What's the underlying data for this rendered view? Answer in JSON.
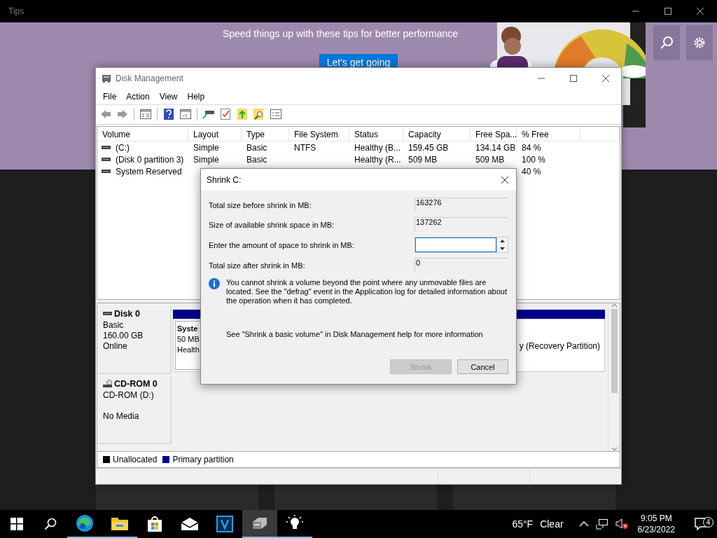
{
  "tips_window": {
    "title": "Tips",
    "banner_text": "Speed things up with these tips for better performance",
    "banner_button": "Let's get going"
  },
  "disk_management": {
    "title": "Disk Management",
    "menu": [
      "File",
      "Action",
      "View",
      "Help"
    ],
    "volume_list": {
      "columns": [
        "Volume",
        "Layout",
        "Type",
        "File System",
        "Status",
        "Capacity",
        "Free Spa...",
        "% Free"
      ],
      "rows": [
        {
          "cells": [
            "(C:)",
            "Simple",
            "Basic",
            "NTFS",
            "Healthy (B...",
            "159.45 GB",
            "134.14 GB",
            "84 %"
          ]
        },
        {
          "cells": [
            "(Disk 0 partition 3)",
            "Simple",
            "Basic",
            null,
            "Healthy (R...",
            "509 MB",
            "509 MB",
            "100 %"
          ]
        },
        {
          "cells": [
            "System Reserved",
            null,
            null,
            null,
            null,
            null,
            null,
            "40 %"
          ]
        }
      ]
    },
    "disks": [
      {
        "kind": "disk",
        "name": "Disk 0",
        "lines": [
          "Basic",
          "160.00 GB",
          "Online"
        ],
        "partitions": [
          {
            "lines": [
              "Syste",
              "50 MB",
              "Health"
            ]
          },
          {
            "lines": [
              "y (Recovery Partition)"
            ]
          }
        ]
      },
      {
        "kind": "cdrom",
        "name": "CD-ROM 0",
        "lines": [
          "CD-ROM (D:)",
          "No Media"
        ]
      }
    ],
    "legend": [
      {
        "label": "Unallocated",
        "color": "#000000"
      },
      {
        "label": "Primary partition",
        "color": "#00008b"
      }
    ]
  },
  "shrink_dialog": {
    "title": "Shrink C:",
    "fields": [
      {
        "kind": "readonly",
        "label": "Total size before shrink in MB:",
        "value": "163276"
      },
      {
        "kind": "readonly",
        "label": "Size of available shrink space in MB:",
        "value": "137262"
      },
      {
        "kind": "spin",
        "label": "Enter the amount of space to shrink in MB:"
      },
      {
        "kind": "readonly",
        "label": "Total size after shrink in MB:",
        "value": "0"
      }
    ],
    "info": "You cannot shrink a volume beyond the point where any unmovable files are located. See the \"defrag\" event in the Application log for detailed information about the operation when it has completed.",
    "help": "See \"Shrink a basic volume\" in Disk Management help for more information",
    "buttons": [
      {
        "label": "Shrink",
        "disabled": true
      },
      {
        "label": "Cancel",
        "disabled": false
      }
    ]
  },
  "taskbar": {
    "apps": [
      {
        "kind": "edge",
        "running": true,
        "selected": false
      },
      {
        "kind": "explorer",
        "running": true,
        "selected": false
      },
      {
        "kind": "store",
        "running": false,
        "selected": false
      },
      {
        "kind": "mail",
        "running": false,
        "selected": false
      },
      {
        "kind": "v-app",
        "running": false,
        "selected": false
      },
      {
        "kind": "disk",
        "running": true,
        "selected": true
      },
      {
        "kind": "bulb",
        "running": true,
        "selected": false
      }
    ],
    "weather": {
      "temperature": "65°F",
      "condition": "Clear"
    },
    "volume_muted": true,
    "clock": {
      "time": "9:05 PM",
      "date": "6/23/2022"
    },
    "notifications": "4"
  }
}
